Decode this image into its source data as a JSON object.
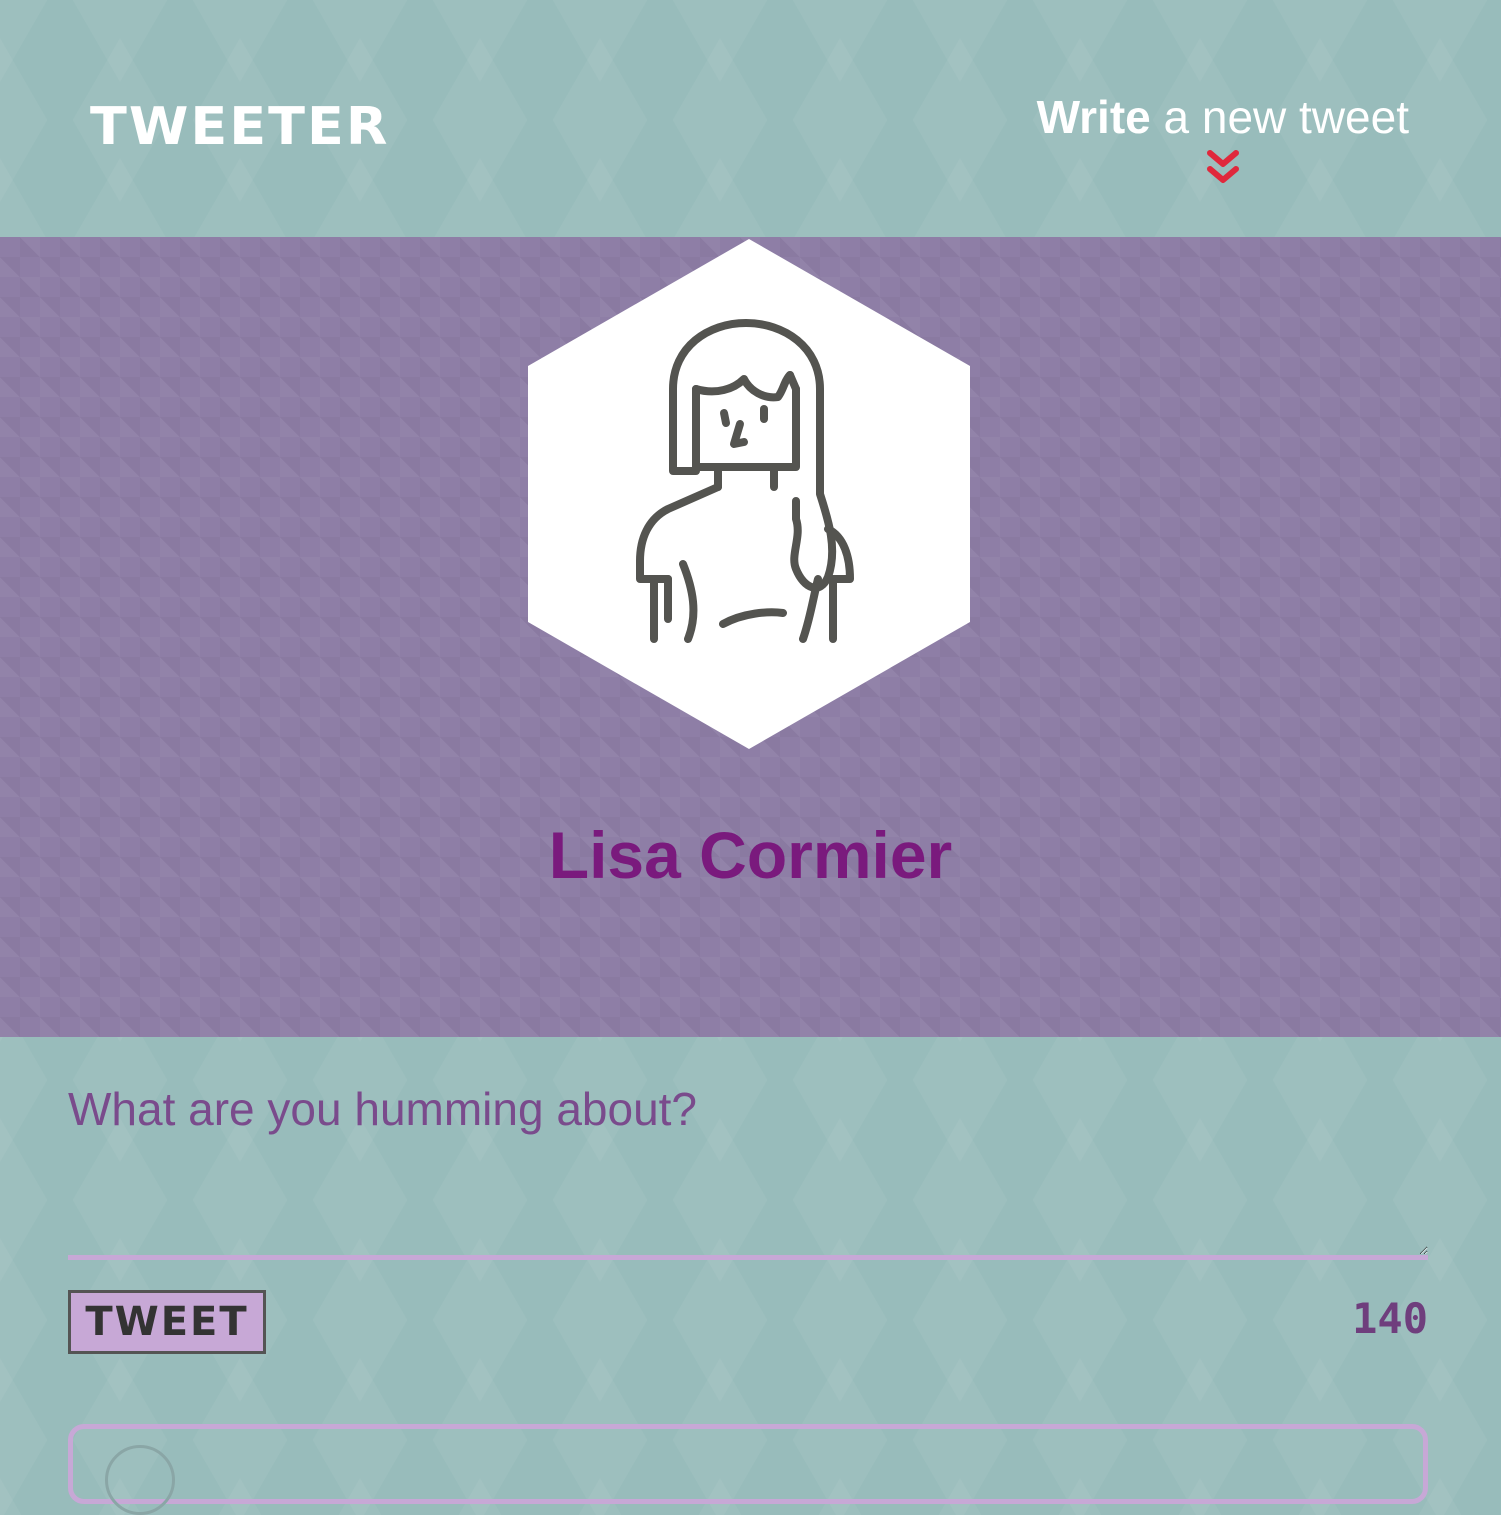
{
  "nav": {
    "logo": "TWEETER",
    "compose_toggle": {
      "strong": "Write",
      "rest": " a new tweet",
      "icon": "double-chevron-down-icon"
    }
  },
  "profile": {
    "name": "Lisa Cormier",
    "avatar": "woman-avatar-icon"
  },
  "compose": {
    "placeholder": "What are you humming about?",
    "value": "",
    "button_label": "TWEET",
    "counter": "140"
  },
  "colors": {
    "page_background": "#98bcbb",
    "profile_background": "#8e7ea6",
    "name_color": "#7a1a7d",
    "accent": "#c7a8d6",
    "chevron": "#e0283c",
    "counter_color": "#6f3e7d"
  }
}
